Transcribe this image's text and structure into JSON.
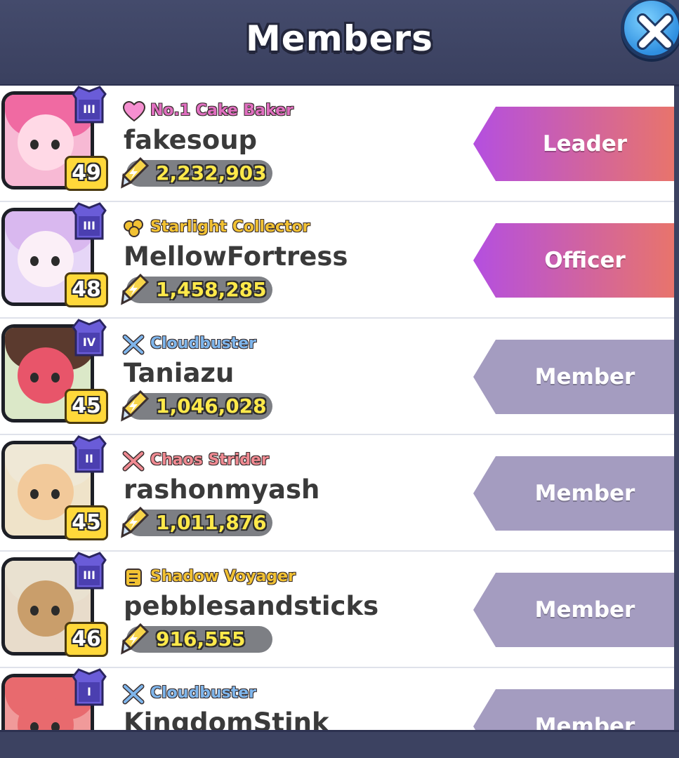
{
  "window": {
    "title": "Members"
  },
  "colors": {
    "leader_role_gradient": [
      "#b44fe0",
      "#e8746c"
    ],
    "member_role": "#a49cc0",
    "power_text": "#ffe94a",
    "panel": "#3c4261"
  },
  "members": [
    {
      "level": "49",
      "rank": "III",
      "title_icon": "heart-icon",
      "title": "No.1 Cake Baker",
      "title_color": "#e06fc0",
      "name": "fakesoup",
      "power": "2,232,903",
      "role": "Leader",
      "avatar_bg": "#f7b9d4",
      "face": "#ffd9e6",
      "hair": "#f06aa2"
    },
    {
      "level": "48",
      "rank": "III",
      "title_icon": "star-cluster-icon",
      "title": "Starlight Collector",
      "title_color": "#f2c233",
      "name": "MellowFortress",
      "power": "1,458,285",
      "role": "Officer",
      "avatar_bg": "#e6d6f7",
      "face": "#fbeff7",
      "hair": "#d9b8ef"
    },
    {
      "level": "45",
      "rank": "IV",
      "title_icon": "crossed-swords-icon",
      "title": "Cloudbuster",
      "title_color": "#7fb6ec",
      "name": "Taniazu",
      "power": "1,046,028",
      "role": "Member",
      "avatar_bg": "#dbe8c8",
      "face": "#e8556a",
      "hair": "#5b3a2e"
    },
    {
      "level": "45",
      "rank": "II",
      "title_icon": "crossed-swords-icon",
      "title": "Chaos Strider",
      "title_color": "#f08a92",
      "name": "rashonmyash",
      "power": "1,011,876",
      "role": "Member",
      "avatar_bg": "#efe3c9",
      "face": "#f2c99a",
      "hair": "#efe8d6"
    },
    {
      "level": "46",
      "rank": "III",
      "title_icon": "scroll-icon",
      "title": "Shadow Voyager",
      "title_color": "#f2c233",
      "name": "pebblesandsticks",
      "power": "916,555",
      "role": "Member",
      "avatar_bg": "#e8dccb",
      "face": "#c99e6b",
      "hair": "#e9e1d0"
    },
    {
      "level": "",
      "rank": "I",
      "title_icon": "crossed-swords-icon",
      "title": "Cloudbuster",
      "title_color": "#7fb6ec",
      "name": "KingdomStink",
      "power": "",
      "role": "Member",
      "avatar_bg": "#f09a9a",
      "face": "#e86a6e",
      "hair": "#e86a6e"
    }
  ]
}
